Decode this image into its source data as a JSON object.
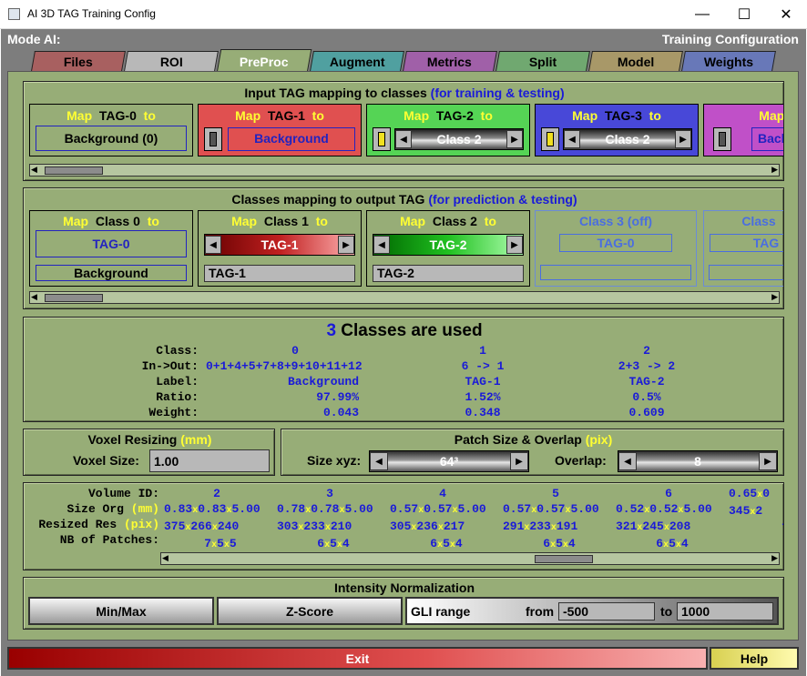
{
  "window": {
    "title": "AI 3D TAG Training Config",
    "minimize": "—",
    "maximize": "☐",
    "close": "✕"
  },
  "header": {
    "mode": "Mode AI:",
    "config": "Training Configuration"
  },
  "tabs": [
    {
      "label": "Files",
      "color": "#a86060"
    },
    {
      "label": "ROI",
      "color": "#b8b8b8"
    },
    {
      "label": "PreProc",
      "color": "#97ad77"
    },
    {
      "label": "Augment",
      "color": "#50a0a0"
    },
    {
      "label": "Metrics",
      "color": "#a060a8"
    },
    {
      "label": "Split",
      "color": "#70a870"
    },
    {
      "label": "Model",
      "color": "#a89868"
    },
    {
      "label": "Weights",
      "color": "#6878b8"
    }
  ],
  "input_map": {
    "title": "Input TAG mapping to classes",
    "title_note": "(for training & testing)",
    "map_word": "Map",
    "to_word": "to",
    "cards": [
      {
        "tag": "TAG-0",
        "value": "Background (0)",
        "bg": "#97ad77"
      },
      {
        "tag": "TAG-1",
        "value": "Background",
        "bg": "#e05050"
      },
      {
        "tag": "TAG-2",
        "value": "Class 2",
        "bg": "#55d455"
      },
      {
        "tag": "TAG-3",
        "value": "Class 2",
        "bg": "#4848d8"
      },
      {
        "tag": "TA",
        "value": "Back",
        "bg": "#c050c8"
      }
    ]
  },
  "class_map": {
    "title": "Classes mapping to output TAG",
    "title_note": "(for prediction & testing)",
    "map_word": "Map",
    "to_word": "to",
    "cards": [
      {
        "cls": "Class 0",
        "tag": "TAG-0",
        "name": "Background"
      },
      {
        "cls": "Class 1",
        "tag": "TAG-1",
        "name": "TAG-1"
      },
      {
        "cls": "Class 2",
        "tag": "TAG-2",
        "name": "TAG-2"
      },
      {
        "cls": "Class 3 (off)",
        "tag": "TAG-0",
        "name": ""
      },
      {
        "cls": "Class",
        "tag": "TAG",
        "name": ""
      }
    ]
  },
  "summary": {
    "count": "3",
    "title": "Classes are used",
    "labels": {
      "class": "Class:",
      "inout": "In->Out:",
      "label": "Label:",
      "ratio": "Ratio:",
      "weight": "Weight:"
    },
    "cols": [
      {
        "cls": "0",
        "inout": "0+1+4+5+7+8+9+10+11+12",
        "label": "Background",
        "ratio": "97.99%",
        "weight": "0.043"
      },
      {
        "cls": "1",
        "inout": "6 -> 1",
        "label": "TAG-1",
        "ratio": "1.52%",
        "weight": "0.348"
      },
      {
        "cls": "2",
        "inout": "2+3 -> 2",
        "label": "TAG-2",
        "ratio": "0.5%",
        "weight": "0.609"
      }
    ]
  },
  "voxel": {
    "title": "Voxel Resizing",
    "unit": "(mm)",
    "label": "Voxel Size:",
    "value": "1.00"
  },
  "patch": {
    "title": "Patch Size & Overlap",
    "unit": "(pix)",
    "size_label": "Size xyz:",
    "size_value": "64³",
    "overlap_label": "Overlap:",
    "overlap_value": "8"
  },
  "volumes": {
    "labels": {
      "id": "Volume ID:",
      "size": "Size Org",
      "size_unit": "(mm)",
      "res": "Resized Res",
      "res_unit": "(pix)",
      "nb": "NB of Patches:"
    },
    "cols": [
      {
        "id": "2",
        "size": [
          "0.83",
          "0.83",
          "5.00"
        ],
        "res": [
          "375",
          "266",
          "240"
        ],
        "nb": [
          "7",
          "5",
          "5"
        ]
      },
      {
        "id": "3",
        "size": [
          "0.78",
          "0.78",
          "5.00"
        ],
        "res": [
          "303",
          "233",
          "210"
        ],
        "nb": [
          "6",
          "5",
          "4"
        ]
      },
      {
        "id": "4",
        "size": [
          "0.57",
          "0.57",
          "5.00"
        ],
        "res": [
          "305",
          "236",
          "217"
        ],
        "nb": [
          "6",
          "5",
          "4"
        ]
      },
      {
        "id": "5",
        "size": [
          "0.57",
          "0.57",
          "5.00"
        ],
        "res": [
          "291",
          "233",
          "191"
        ],
        "nb": [
          "6",
          "5",
          "4"
        ]
      },
      {
        "id": "6",
        "size": [
          "0.52",
          "0.52",
          "5.00"
        ],
        "res": [
          "321",
          "245",
          "208"
        ],
        "nb": [
          "6",
          "5",
          "4"
        ]
      },
      {
        "id": "",
        "size": [
          "0.65",
          "0",
          ""
        ],
        "res": [
          "345",
          "2",
          ""
        ],
        "nb": [
          "7",
          "",
          ""
        ]
      }
    ]
  },
  "norm": {
    "title": "Intensity Normalization",
    "minmax": "Min/Max",
    "zscore": "Z-Score",
    "gli": "GLI range",
    "from_label": "from",
    "from_value": "-500",
    "to_label": "to",
    "to_value": "1000"
  },
  "footer": {
    "exit": "Exit",
    "help": "Help"
  }
}
